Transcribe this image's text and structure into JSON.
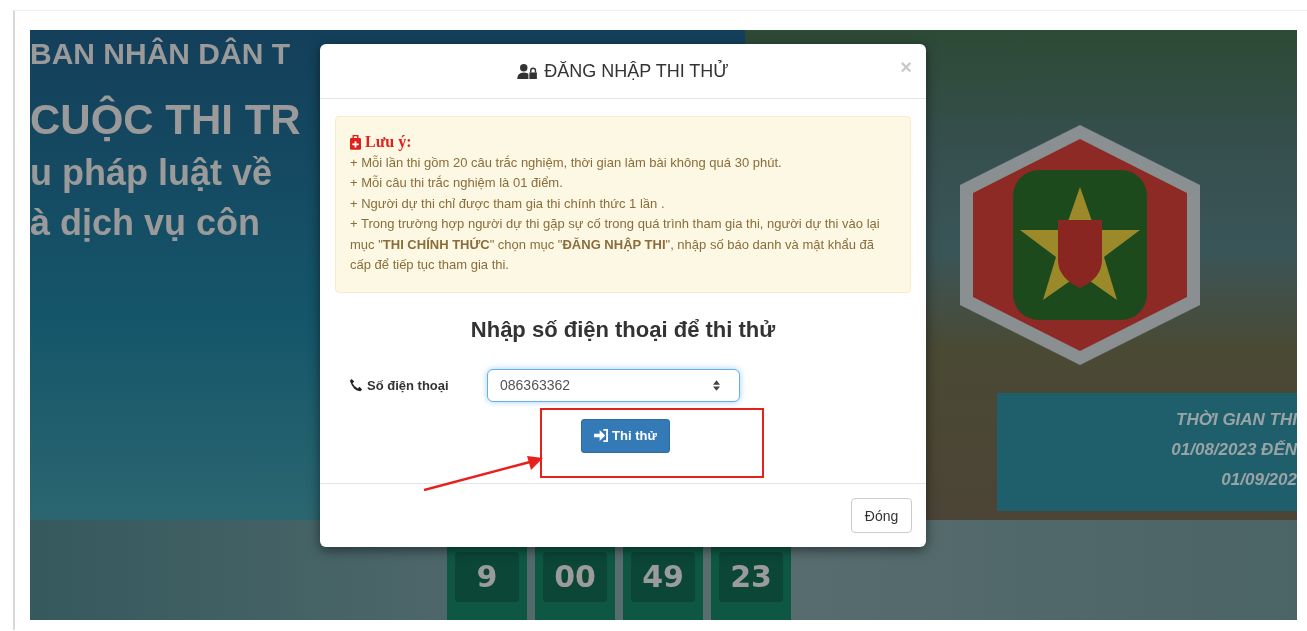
{
  "banner": {
    "heading_lines": [
      "BAN NHÂN DÂN T",
      "CUỘC THI TR",
      "u pháp luật về",
      "à dịch vụ côn"
    ],
    "exam_period_lines": [
      "THỜI GIAN THI",
      "01/08/2023 ĐẾN",
      "01/09/202"
    ],
    "countdown": [
      {
        "value": "9"
      },
      {
        "value": "00"
      },
      {
        "value": "49"
      },
      {
        "value": "23"
      }
    ]
  },
  "modal": {
    "title": "ĐĂNG NHẬP THI THỬ",
    "close": "×",
    "notice": {
      "heading": "Lưu ý:",
      "items": [
        "+ Mỗi lần thi gồm 20 câu trắc nghiệm, thời gian làm bài không quá 30 phút.",
        "+ Mỗi câu thi trắc nghiệm là 01 điểm.",
        "+ Người dự thi chỉ được tham gia thi chính thức 1 lần .",
        "+ Trong trường hợp người dự thi gặp sự cố trong quá trình tham gia thi, người dự thi vào lại mục \"**THI CHÍNH THỨC**\" chọn mục \"**ĐĂNG NHẬP THI**\", nhập số báo danh và mật khẩu đã cấp để tiếp tục tham gia thi."
      ]
    },
    "form_title": "Nhập số điện thoại để thi thử",
    "phone_field": {
      "label": "Số điện thoại",
      "value": "086363362"
    },
    "submit_button": "Thi thử",
    "close_button": "Đóng"
  }
}
